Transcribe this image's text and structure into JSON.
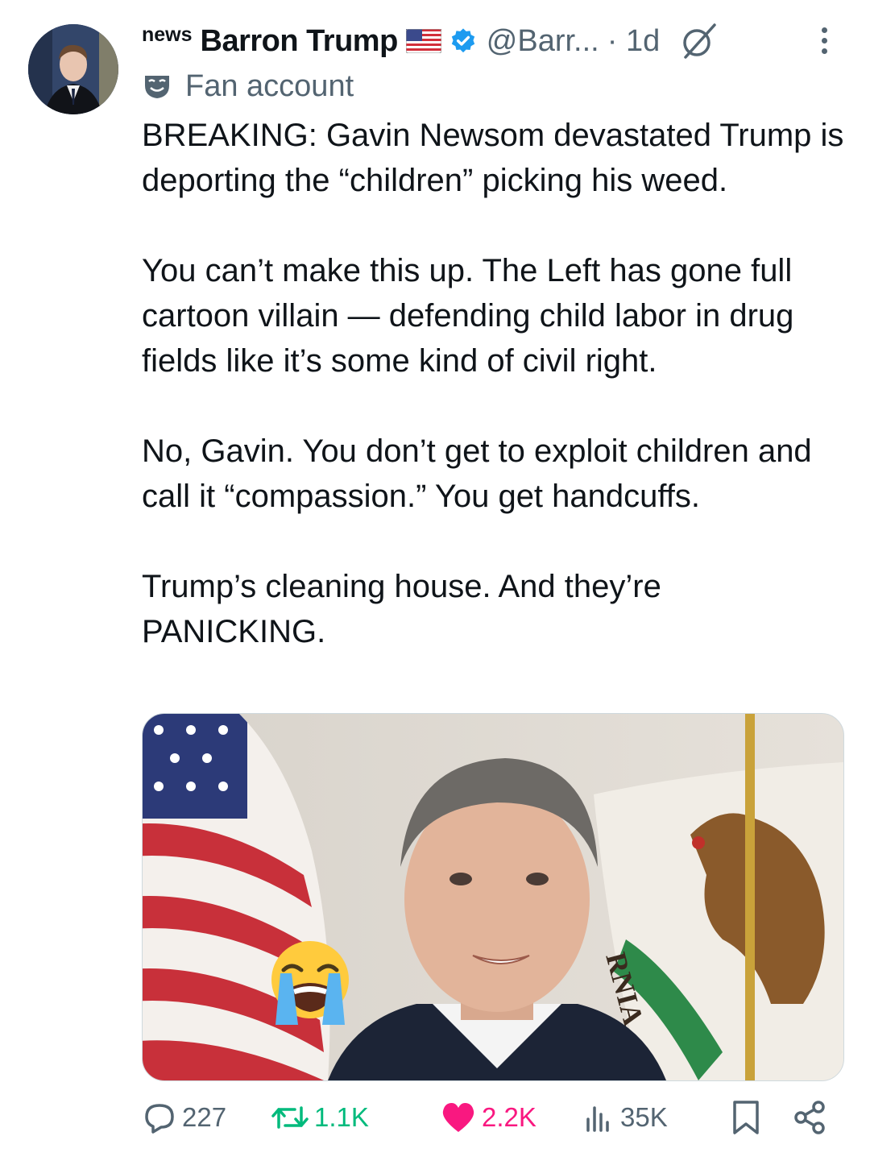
{
  "post": {
    "news_badge": "news",
    "author_name": "Barron Trump",
    "handle": "@Barr...",
    "time": "· 1d",
    "affiliation_label": "Fan account",
    "paragraphs": [
      "BREAKING: Gavin Newsom devastated Trump is deporting the “children” picking his weed.",
      "You can’t make this up. The Left has gone full cartoon villain — defending child labor in drug fields like it’s some kind of civil right.",
      "No, Gavin. You don’t get to exploit children and call it “compassion.” You get handcuffs.",
      "Trump’s cleaning house. And they’re PANICKING."
    ],
    "media_flag_text": "RNIA"
  },
  "actions": {
    "replies": "227",
    "reposts": "1.1K",
    "likes": "2.2K",
    "views": "35K"
  },
  "colors": {
    "text": "#0f1419",
    "secondary": "#536471",
    "verified": "#1d9bf0",
    "repost": "#00ba7c",
    "like": "#f91880"
  },
  "icons": [
    "verified-badge-icon",
    "us-flag-icon",
    "null-icon",
    "more-icon",
    "fan-mask-icon",
    "reply-icon",
    "repost-icon",
    "like-icon",
    "views-icon",
    "bookmark-icon",
    "share-icon",
    "crying-emoji-icon"
  ]
}
